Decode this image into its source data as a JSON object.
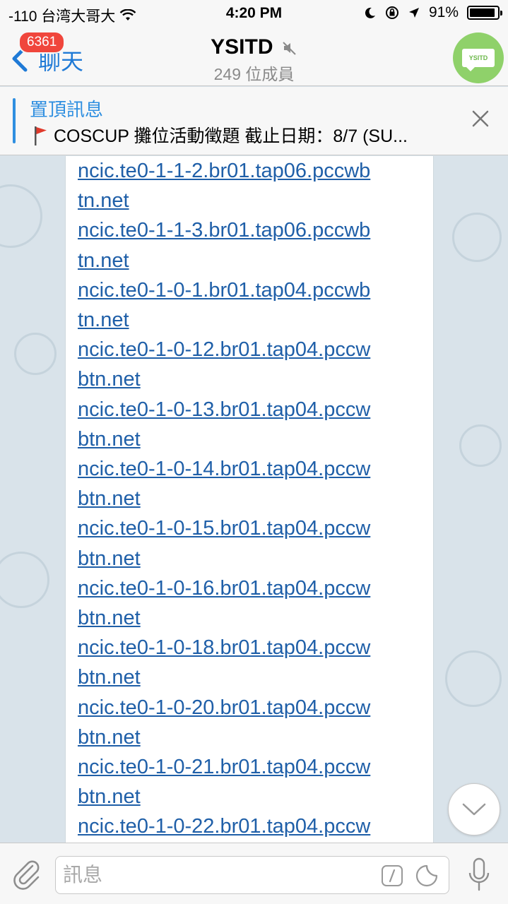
{
  "status_bar": {
    "carrier": "-110 台湾大哥大",
    "time": "4:20 PM",
    "battery_percent": "91%",
    "battery_level": 0.91
  },
  "header": {
    "back_badge": "6361",
    "back_label": "聊天",
    "title": "YSITD",
    "subtitle": "249 位成員",
    "avatar_text": "YSITD",
    "avatar_color": "#8fd16a"
  },
  "pinned": {
    "title": "置頂訊息",
    "text": "COSCUP 攤位活動徵題 截止日期：8/7 (SU..."
  },
  "message": {
    "lines": [
      "ncic.te0-1-1-2.br01.tap06.pccwb",
      "tn.net",
      "ncic.te0-1-1-3.br01.tap06.pccwb",
      "tn.net",
      "ncic.te0-1-0-1.br01.tap04.pccwb",
      "tn.net",
      "ncic.te0-1-0-12.br01.tap04.pccw",
      "btn.net",
      "ncic.te0-1-0-13.br01.tap04.pccw",
      "btn.net",
      "ncic.te0-1-0-14.br01.tap04.pccw",
      "btn.net",
      "ncic.te0-1-0-15.br01.tap04.pccw",
      "btn.net",
      "ncic.te0-1-0-16.br01.tap04.pccw",
      "btn.net",
      "ncic.te0-1-0-18.br01.tap04.pccw",
      "btn.net",
      "ncic.te0-1-0-20.br01.tap04.pccw",
      "btn.net",
      "ncic.te0-1-0-21.br01.tap04.pccw",
      "btn.net",
      "ncic.te0-1-0-22.br01.tap04.pccw"
    ]
  },
  "input": {
    "placeholder": "訊息"
  },
  "colors": {
    "accent": "#1f7ad6",
    "link": "#1f5fa8",
    "badge": "#f0463c"
  }
}
